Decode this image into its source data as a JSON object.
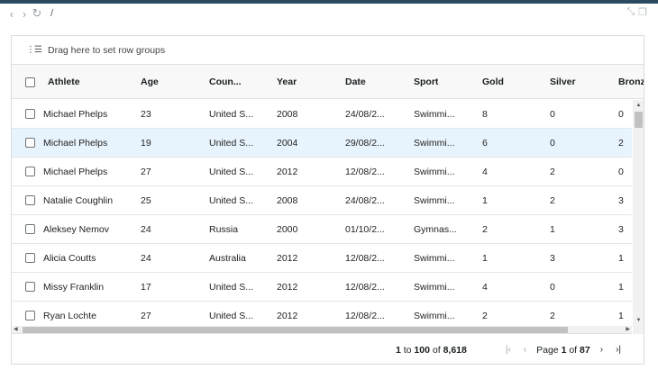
{
  "browser": {
    "address": "/"
  },
  "group_bar": {
    "label": "Drag here to set row groups"
  },
  "columns": [
    {
      "key": "athlete",
      "label": "Athlete"
    },
    {
      "key": "age",
      "label": "Age"
    },
    {
      "key": "country",
      "label": "Coun..."
    },
    {
      "key": "year",
      "label": "Year"
    },
    {
      "key": "date",
      "label": "Date"
    },
    {
      "key": "sport",
      "label": "Sport"
    },
    {
      "key": "gold",
      "label": "Gold"
    },
    {
      "key": "silver",
      "label": "Silver"
    },
    {
      "key": "bronze",
      "label": "Bronze"
    }
  ],
  "rows": [
    {
      "athlete": "Michael Phelps",
      "age": "23",
      "country": "United S...",
      "year": "2008",
      "date": "24/08/2...",
      "sport": "Swimmi...",
      "gold": "8",
      "silver": "0",
      "bronze": "0",
      "selected": false
    },
    {
      "athlete": "Michael Phelps",
      "age": "19",
      "country": "United S...",
      "year": "2004",
      "date": "29/08/2...",
      "sport": "Swimmi...",
      "gold": "6",
      "silver": "0",
      "bronze": "2",
      "selected": true
    },
    {
      "athlete": "Michael Phelps",
      "age": "27",
      "country": "United S...",
      "year": "2012",
      "date": "12/08/2...",
      "sport": "Swimmi...",
      "gold": "4",
      "silver": "2",
      "bronze": "0",
      "selected": false
    },
    {
      "athlete": "Natalie Coughlin",
      "age": "25",
      "country": "United S...",
      "year": "2008",
      "date": "24/08/2...",
      "sport": "Swimmi...",
      "gold": "1",
      "silver": "2",
      "bronze": "3",
      "selected": false
    },
    {
      "athlete": "Aleksey Nemov",
      "age": "24",
      "country": "Russia",
      "year": "2000",
      "date": "01/10/2...",
      "sport": "Gymnas...",
      "gold": "2",
      "silver": "1",
      "bronze": "3",
      "selected": false
    },
    {
      "athlete": "Alicia Coutts",
      "age": "24",
      "country": "Australia",
      "year": "2012",
      "date": "12/08/2...",
      "sport": "Swimmi...",
      "gold": "1",
      "silver": "3",
      "bronze": "1",
      "selected": false
    },
    {
      "athlete": "Missy Franklin",
      "age": "17",
      "country": "United S...",
      "year": "2012",
      "date": "12/08/2...",
      "sport": "Swimmi...",
      "gold": "4",
      "silver": "0",
      "bronze": "1",
      "selected": false
    },
    {
      "athlete": "Ryan Lochte",
      "age": "27",
      "country": "United S...",
      "year": "2012",
      "date": "12/08/2...",
      "sport": "Swimmi...",
      "gold": "2",
      "silver": "2",
      "bronze": "1",
      "selected": false
    }
  ],
  "pagination": {
    "row_start": "1",
    "to_word": "to",
    "row_end": "100",
    "of_word": "of",
    "row_total": "8,618",
    "page_word": "Page",
    "current_page": "1",
    "page_of_word": "of",
    "total_pages": "87"
  },
  "icons": {
    "back": "chevron-left-icon",
    "forward": "chevron-right-icon",
    "reload": "refresh-icon",
    "group": "row-group-icon",
    "first_page": "first-page-icon",
    "prev_page": "prev-page-icon",
    "next_page": "next-page-icon",
    "last_page": "last-page-icon"
  },
  "colors": {
    "selected_row": "#e8f4fd",
    "header_bg": "#f8f8f8",
    "top_bar": "#2b4a5f"
  }
}
